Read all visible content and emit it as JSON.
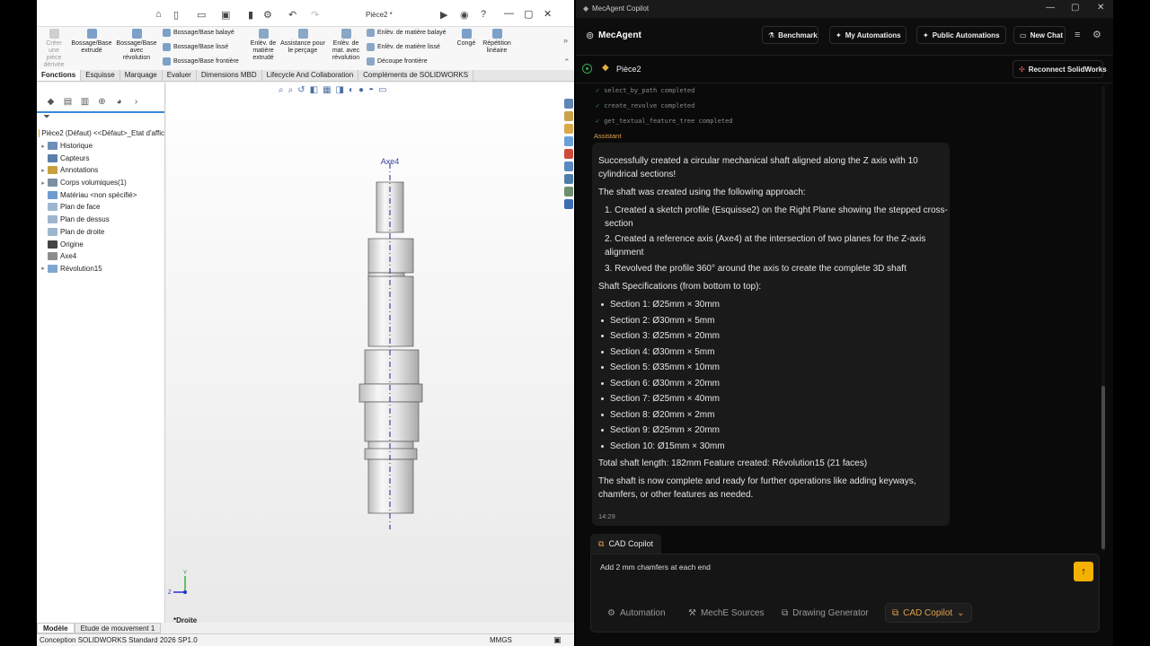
{
  "solidworks": {
    "doc_title": "Pièce2 *",
    "ribbon": {
      "create_part": "Créer une pièce dérivée",
      "extrude": "Bossage/Base extrudé",
      "revolve": "Bossage/Base avec révolution",
      "sweep": "Bossage/Base balayé",
      "loft": "Bossage/Base lissé",
      "boundary": "Bossage/Base frontière",
      "cut_extrude": "Enlèv. de matière extrudé",
      "hole_wizard": "Assistance pour le perçage",
      "cut_revolve": "Enlèv. de mat. avec révolution",
      "cut_sweep": "Enlèv. de matière balayé",
      "cut_loft": "Enlèv. de matière lissé",
      "cut_boundary": "Découpe frontière",
      "fillet": "Congé",
      "pattern": "Répétition linéaire"
    },
    "tabs": [
      {
        "label": "Fonctions",
        "active": true
      },
      {
        "label": "Esquisse"
      },
      {
        "label": "Marquage"
      },
      {
        "label": "Evaluer"
      },
      {
        "label": "Dimensions MBD"
      },
      {
        "label": "Lifecycle And Collaboration"
      },
      {
        "label": "Compléments de SOLIDWORKS"
      }
    ],
    "tree": [
      {
        "label": "Pièce2 (Défaut) <<Défaut>_Etat d'affic",
        "arrow": "",
        "color": "#d9a423"
      },
      {
        "label": "Historique",
        "arrow": "▸",
        "color": "#6d8fb8"
      },
      {
        "label": "Capteurs",
        "arrow": "",
        "color": "#5a7fa8"
      },
      {
        "label": "Annotations",
        "arrow": "▸",
        "color": "#c8a040"
      },
      {
        "label": "Corps volumiques(1)",
        "arrow": "▸",
        "color": "#7d8fa2"
      },
      {
        "label": "Matériau <non spécifié>",
        "arrow": "",
        "color": "#6e9ccf"
      },
      {
        "label": "Plan de face",
        "arrow": "",
        "color": "#9fb6cf"
      },
      {
        "label": "Plan de dessus",
        "arrow": "",
        "color": "#9fb6cf"
      },
      {
        "label": "Plan de droite",
        "arrow": "",
        "color": "#9fb6cf"
      },
      {
        "label": "Origine",
        "arrow": "",
        "color": "#444444"
      },
      {
        "label": "Axe4",
        "arrow": "",
        "color": "#8d8d8d"
      },
      {
        "label": "Révolution15",
        "arrow": "▸",
        "color": "#7fa6cf"
      }
    ],
    "axis_label": "Axe4",
    "view_name": "*Droite",
    "bottom_tabs": [
      {
        "label": "Modèle",
        "active": true
      },
      {
        "label": "Etude de mouvement 1"
      }
    ],
    "status_left": "Conception SOLIDWORKS Standard 2026 SP1.0",
    "units": "MMGS"
  },
  "mecagent": {
    "window_title": "MecAgent Copilot",
    "logo": "MecAgent",
    "nav": {
      "benchmark": "Benchmark",
      "my_automations": "My Automations",
      "public_automations": "Public Automations",
      "new_chat": "New Chat"
    },
    "document": "Pièce2",
    "reconnect": "Reconnect SolidWorks",
    "tool_calls": [
      "select_by_path completed",
      "create_revolve completed",
      "get_textual_feature_tree completed"
    ],
    "role_label": "Assistant",
    "message": {
      "intro_1": "Successfully created a circular mechanical shaft aligned along the Z axis with 10",
      "intro_2": "cylindrical sections!",
      "approach": "The shaft was created using the following approach:",
      "step1a": "1. Created a sketch profile (Esquisse2) on the Right Plane showing the stepped cross-",
      "step1b": "section",
      "step2a": "2. Created a reference axis (Axe4) at the intersection of two planes for the Z-axis",
      "step2b": "alignment",
      "step3": "3. Revolved the profile 360° around the axis to create the complete 3D shaft",
      "spec_title": "Shaft Specifications (from bottom to top):",
      "sections": [
        "Section 1: Ø25mm × 30mm",
        "Section 2: Ø30mm × 5mm",
        "Section 3: Ø25mm × 20mm",
        "Section 4: Ø30mm × 5mm",
        "Section 5: Ø35mm × 10mm",
        "Section 6: Ø30mm × 20mm",
        "Section 7: Ø25mm × 40mm",
        "Section 8: Ø20mm × 2mm",
        "Section 9: Ø25mm × 20mm",
        "Section 10: Ø15mm × 30mm"
      ],
      "total": "Total shaft length: 182mm Feature created: Révolution15 (21 faces)",
      "closing_1": "The shaft is now complete and ready for further operations like adding keyways,",
      "closing_2": "chamfers, or other features as needed.",
      "time": "14:29"
    },
    "cad_tag": "CAD Copilot",
    "input_value": "Add 2 mm chamfers at each end",
    "modes": {
      "automation": "Automation",
      "sources": "MechE Sources",
      "drawing": "Drawing Generator",
      "cad": "CAD Copilot"
    },
    "colors": {
      "accent": "#f5b100",
      "success": "#35a853",
      "assistant_label": "#e0a24a"
    }
  }
}
